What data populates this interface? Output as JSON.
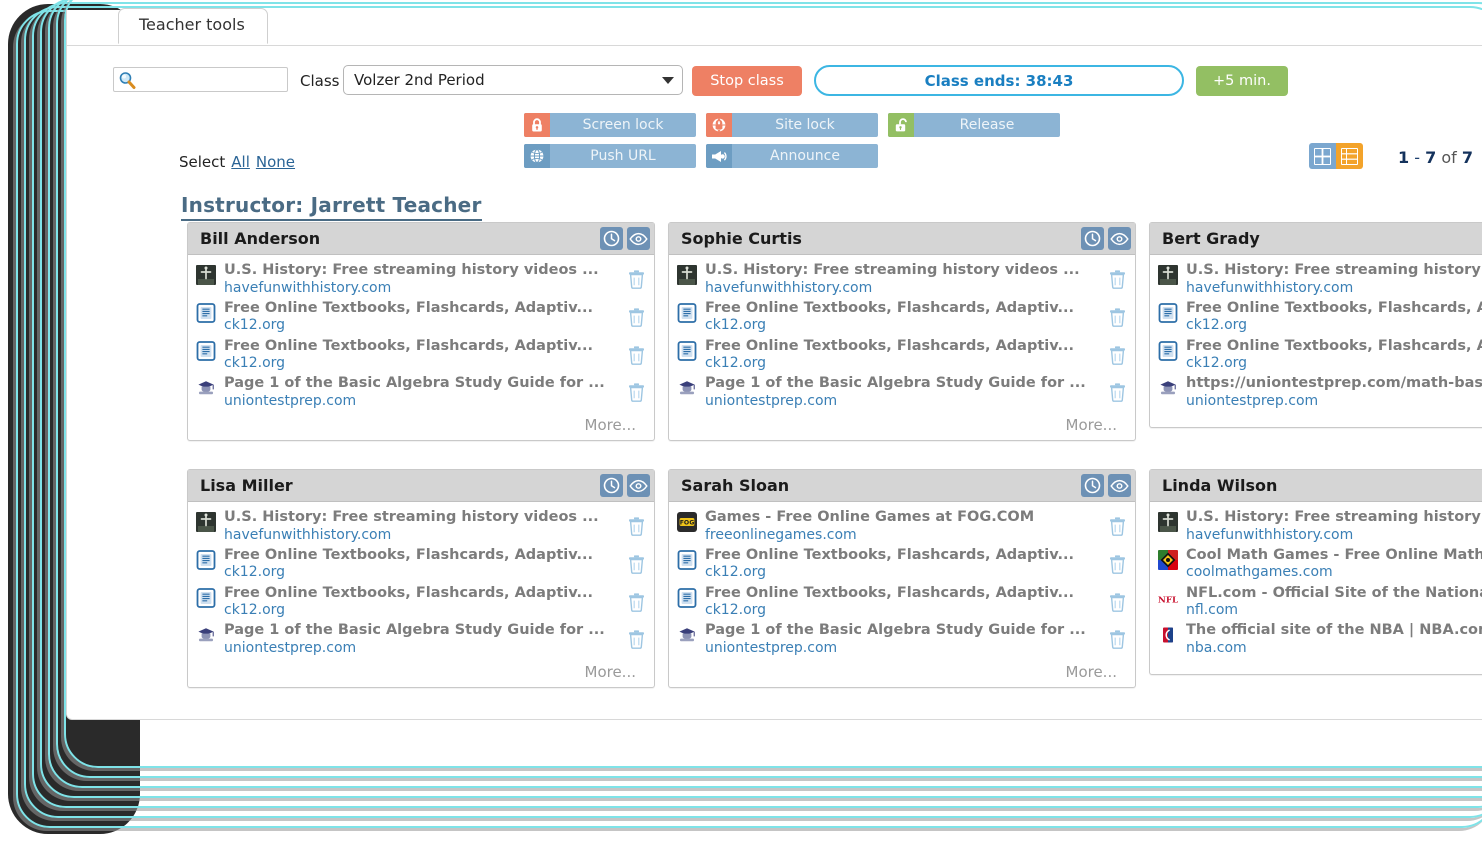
{
  "window": {
    "tab_label": "Teacher tools"
  },
  "toolbar": {
    "search_placeholder": "",
    "search_value": "",
    "class_label": "Class",
    "class_selected": "Volzer 2nd Period",
    "stop_class_label": "Stop class",
    "class_ends_label": "Class ends: 38:43",
    "plus5_label": "+5 min.",
    "actions": [
      {
        "id": "screen-lock",
        "label": "Screen lock",
        "icon": "lock-closed-icon",
        "icon_color": "#ee8064"
      },
      {
        "id": "site-lock",
        "label": "Site lock",
        "icon": "globe-lock-icon",
        "icon_color": "#ee8064"
      },
      {
        "id": "release",
        "label": "Release",
        "icon": "lock-open-icon",
        "icon_color": "#93bf63"
      },
      {
        "id": "push-url",
        "label": "Push URL",
        "icon": "globe-icon",
        "icon_color": "#6d9dc2"
      },
      {
        "id": "announce",
        "label": "Announce",
        "icon": "megaphone-icon",
        "icon_color": "#6d9dc2"
      }
    ],
    "select_label": "Select",
    "select_all_label": "All",
    "select_none_label": "None"
  },
  "view": {
    "grid_icon": "grid-view-icon",
    "list_icon": "list-view-icon",
    "active": "list"
  },
  "pagination": {
    "range_start": "1",
    "dash": "-",
    "range_end": "7",
    "of": "of",
    "total": "7",
    "prev_label": "«"
  },
  "instructor": {
    "label": "Instructor: Jarrett Teacher"
  },
  "colors": {
    "accent_blue": "#3cb6e3",
    "salmon": "#ee8064",
    "green": "#93bf63",
    "button_blue": "#8cb4d4",
    "orange_active": "#f3a32a",
    "card_header": "#d5d5d5",
    "link": "#3a7fb5",
    "title_gray": "#7c7c7c"
  },
  "students": [
    {
      "name": "Bill Anderson",
      "has_icons": true,
      "has_more": true,
      "more_label": "More...",
      "rows": [
        {
          "title": "U.S. History: Free streaming history videos ...",
          "url": "havefunwithhistory.com",
          "favicon": "statue-favicon"
        },
        {
          "title": "Free Online Textbooks, Flashcards, Adaptiv...",
          "url": "ck12.org",
          "favicon": "ck12-favicon"
        },
        {
          "title": "Free Online Textbooks, Flashcards, Adaptiv...",
          "url": "ck12.org",
          "favicon": "ck12-favicon"
        },
        {
          "title": "Page 1 of the Basic Algebra Study Guide for ...",
          "url": "uniontestprep.com",
          "favicon": "uniontestprep-favicon"
        }
      ]
    },
    {
      "name": "Sophie Curtis",
      "has_icons": true,
      "has_more": true,
      "more_label": "More...",
      "rows": [
        {
          "title": "U.S. History: Free streaming history videos ...",
          "url": "havefunwithhistory.com",
          "favicon": "statue-favicon"
        },
        {
          "title": "Free Online Textbooks, Flashcards, Adaptiv...",
          "url": "ck12.org",
          "favicon": "ck12-favicon"
        },
        {
          "title": "Free Online Textbooks, Flashcards, Adaptiv...",
          "url": "ck12.org",
          "favicon": "ck12-favicon"
        },
        {
          "title": "Page 1 of the Basic Algebra Study Guide for ...",
          "url": "uniontestprep.com",
          "favicon": "uniontestprep-favicon"
        }
      ]
    },
    {
      "name": "Bert Grady",
      "has_icons": false,
      "has_more": false,
      "more_label": "",
      "rows": [
        {
          "title": "U.S. History: Free streaming history videos ...",
          "url": "havefunwithhistory.com",
          "favicon": "statue-favicon"
        },
        {
          "title": "Free Online Textbooks, Flashcards, Adaptiv...",
          "url": "ck12.org",
          "favicon": "ck12-favicon"
        },
        {
          "title": "Free Online Textbooks, Flashcards, Adaptiv...",
          "url": "ck12.org",
          "favicon": "ck12-favicon"
        },
        {
          "title": "https://uniontestprep.com/math-basics/s...",
          "url": "uniontestprep.com",
          "favicon": "uniontestprep-favicon"
        }
      ]
    },
    {
      "name": "Lisa Miller",
      "has_icons": true,
      "has_more": true,
      "more_label": "More...",
      "rows": [
        {
          "title": "U.S. History: Free streaming history videos ...",
          "url": "havefunwithhistory.com",
          "favicon": "statue-favicon"
        },
        {
          "title": "Free Online Textbooks, Flashcards, Adaptiv...",
          "url": "ck12.org",
          "favicon": "ck12-favicon"
        },
        {
          "title": "Free Online Textbooks, Flashcards, Adaptiv...",
          "url": "ck12.org",
          "favicon": "ck12-favicon"
        },
        {
          "title": "Page 1 of the Basic Algebra Study Guide for ...",
          "url": "uniontestprep.com",
          "favicon": "uniontestprep-favicon"
        }
      ]
    },
    {
      "name": "Sarah Sloan",
      "has_icons": true,
      "has_more": true,
      "more_label": "More...",
      "rows": [
        {
          "title": "Games - Free Online Games at FOG.COM",
          "url": "freeonlinegames.com",
          "favicon": "fog-favicon"
        },
        {
          "title": "Free Online Textbooks, Flashcards, Adaptiv...",
          "url": "ck12.org",
          "favicon": "ck12-favicon"
        },
        {
          "title": "Free Online Textbooks, Flashcards, Adaptiv...",
          "url": "ck12.org",
          "favicon": "ck12-favicon"
        },
        {
          "title": "Page 1 of the Basic Algebra Study Guide for ...",
          "url": "uniontestprep.com",
          "favicon": "uniontestprep-favicon"
        }
      ]
    },
    {
      "name": "Linda Wilson",
      "has_icons": false,
      "has_more": false,
      "more_label": "",
      "rows": [
        {
          "title": "U.S. History: Free streaming history videos ...",
          "url": "havefunwithhistory.com",
          "favicon": "statue-favicon"
        },
        {
          "title": "Cool Math Games - Free Online Math Game...",
          "url": "coolmathgames.com",
          "favicon": "coolmath-favicon"
        },
        {
          "title": "NFL.com - Official Site of the National Foot...",
          "url": "nfl.com",
          "favicon": "nfl-favicon"
        },
        {
          "title": "The official site of the NBA | NBA.com",
          "url": "nba.com",
          "favicon": "nba-favicon"
        }
      ]
    }
  ]
}
